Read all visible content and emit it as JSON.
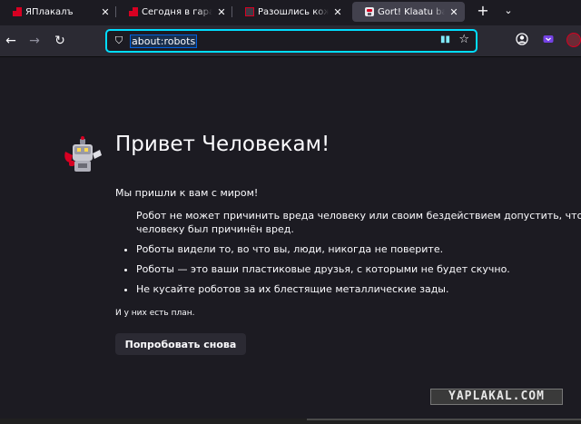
{
  "tabs": [
    {
      "title": "ЯПлакалъ",
      "favicon": "yaplakal-favicon",
      "active": false
    },
    {
      "title": "Сегодня в гаражах C",
      "favicon": "yaplakal-favicon",
      "active": false
    },
    {
      "title": "Разошлись кожаные",
      "favicon": "yaplakal-favicon-dark",
      "active": false
    },
    {
      "title": "Gort! Klaatu barada n",
      "favicon": "robot-favicon",
      "active": true
    }
  ],
  "tab_close_glyph": "✕",
  "new_tab_glyph": "+",
  "list_tabs_glyph": "⌄",
  "urlbar": {
    "value": "about:robots",
    "focus_color": "#00ddff"
  },
  "nav": {
    "back_glyph": "←",
    "forward_glyph": "→",
    "reload_glyph": "↻",
    "shield_glyph": "⛉",
    "reader_glyph": "▮▮",
    "star_glyph": "☆"
  },
  "page": {
    "title": "Привет Человекам!",
    "intro": "Мы пришли к вам с миром!",
    "items": [
      "Робот не может причинить вреда человеку или своим бездействием допустить, чтобы человеку был причинён вред.",
      "Роботы видели то, во что вы, люди, никогда не поверите.",
      "Роботы — это ваши пластиковые друзья, с которыми не будет скучно.",
      "Не кусайте роботов за их блестящие металлические зады."
    ],
    "plan": "И у них есть план.",
    "button": "Попробовать снова"
  },
  "watermark": "YAPLAKAL.COM",
  "colors": {
    "background": "#1c1b22",
    "toolbar": "#2b2a33",
    "text": "#fbfbfe",
    "accent": "#00ddff"
  }
}
